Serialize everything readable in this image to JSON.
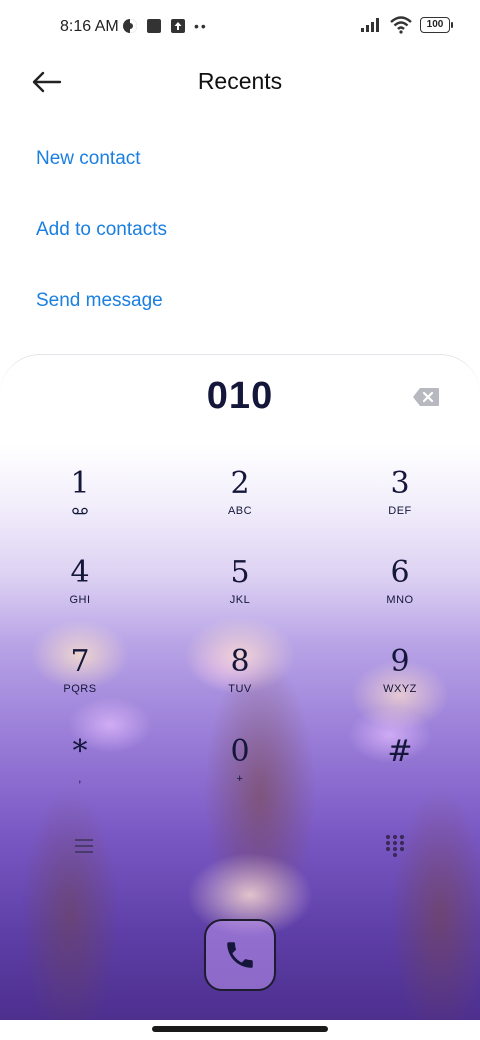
{
  "status_bar": {
    "time": "8:16 AM",
    "left_icons": [
      "theme-icon",
      "square-icon",
      "upload-icon",
      "more-dots-icon"
    ],
    "signal_icon": "signal-icon",
    "wifi_icon": "wifi-icon",
    "battery": "100"
  },
  "header": {
    "back_icon": "back-arrow-icon",
    "title": "Recents"
  },
  "actions": {
    "new_contact": "New contact",
    "add_to_contacts": "Add to contacts",
    "send_message": "Send message"
  },
  "dialer": {
    "number": "010",
    "backspace_icon": "backspace-icon",
    "keys": [
      {
        "digit": "1",
        "letters": "",
        "sub_icon": "voicemail-icon"
      },
      {
        "digit": "2",
        "letters": "ABC"
      },
      {
        "digit": "3",
        "letters": "DEF"
      },
      {
        "digit": "4",
        "letters": "GHI"
      },
      {
        "digit": "5",
        "letters": "JKL"
      },
      {
        "digit": "6",
        "letters": "MNO"
      },
      {
        "digit": "7",
        "letters": "PQRS"
      },
      {
        "digit": "8",
        "letters": "TUV"
      },
      {
        "digit": "9",
        "letters": "WXYZ"
      },
      {
        "digit": "*",
        "letters": ","
      },
      {
        "digit": "0",
        "letters": "+"
      },
      {
        "digit": "#",
        "letters": ""
      }
    ],
    "menu_icon": "menu-icon",
    "keypad_icon": "keypad-icon",
    "call_icon": "phone-icon"
  },
  "colors": {
    "accent": "#1a7fe0",
    "digit": "#14163a"
  }
}
